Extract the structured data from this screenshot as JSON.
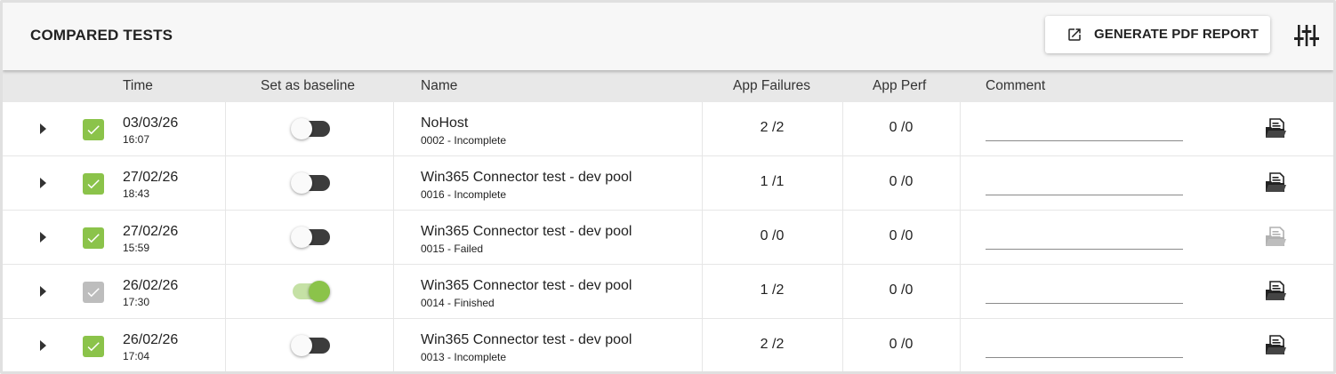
{
  "header": {
    "title": "COMPARED TESTS",
    "pdf_button_label": "GENERATE PDF REPORT",
    "icons": [
      "open-in-new-icon",
      "tune-icon"
    ]
  },
  "columns": {
    "time": "Time",
    "baseline": "Set as baseline",
    "name": "Name",
    "app_failures": "App Failures",
    "app_perf": "App Perf",
    "comment": "Comment"
  },
  "colors": {
    "accent_green": "#8bc34a",
    "toggle_track_off": "#3c3c3c",
    "toggle_track_on": "#c5e1a5",
    "header_bg": "#f7f7f7",
    "column_header_bg": "#e8e8e8"
  },
  "rows": [
    {
      "checked": true,
      "check_style": "green",
      "date": "03/03/26",
      "time": "16:07",
      "baseline": false,
      "name": "NoHost",
      "sub": "0002 - Incomplete",
      "app_failures": "2 /2",
      "app_perf": "0 /0",
      "comment": "",
      "report_enabled": true
    },
    {
      "checked": true,
      "check_style": "green",
      "date": "27/02/26",
      "time": "18:43",
      "baseline": false,
      "name": "Win365 Connector test - dev pool",
      "sub": "0016 - Incomplete",
      "app_failures": "1 /1",
      "app_perf": "0 /0",
      "comment": "",
      "report_enabled": true
    },
    {
      "checked": true,
      "check_style": "green",
      "date": "27/02/26",
      "time": "15:59",
      "baseline": false,
      "name": "Win365 Connector test - dev pool",
      "sub": "0015 - Failed",
      "app_failures": "0 /0",
      "app_perf": "0 /0",
      "comment": "",
      "report_enabled": false
    },
    {
      "checked": true,
      "check_style": "grey",
      "date": "26/02/26",
      "time": "17:30",
      "baseline": true,
      "name": "Win365 Connector test - dev pool",
      "sub": "0014 - Finished",
      "app_failures": "1 /2",
      "app_perf": "0 /0",
      "comment": "",
      "report_enabled": true
    },
    {
      "checked": true,
      "check_style": "green",
      "date": "26/02/26",
      "time": "17:04",
      "baseline": false,
      "name": "Win365 Connector test - dev pool",
      "sub": "0013 - Incomplete",
      "app_failures": "2 /2",
      "app_perf": "0 /0",
      "comment": "",
      "report_enabled": true
    }
  ]
}
